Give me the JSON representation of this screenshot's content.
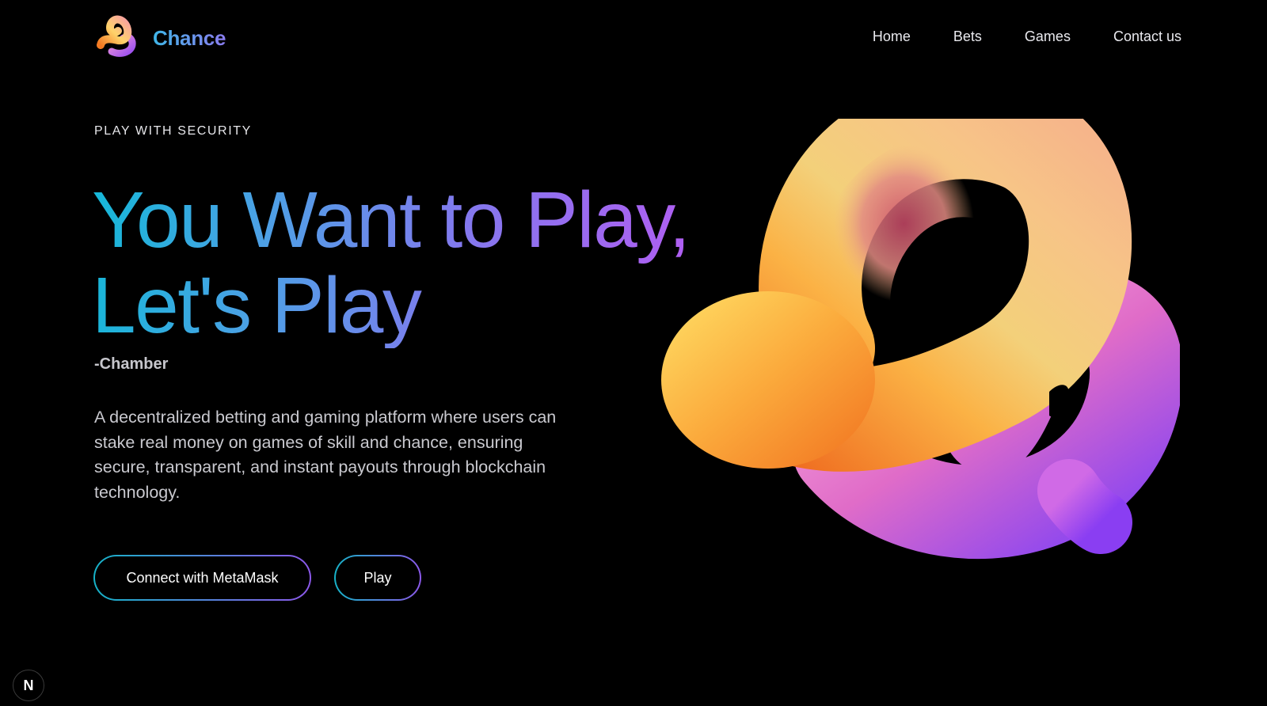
{
  "brand": {
    "name": "Chance",
    "logo_icon": "swirl-knot-icon"
  },
  "nav": {
    "items": [
      {
        "label": "Home"
      },
      {
        "label": "Bets"
      },
      {
        "label": "Games"
      },
      {
        "label": "Contact us"
      }
    ]
  },
  "hero": {
    "eyebrow": "PLAY WITH SECURITY",
    "headline_line1": "You Want to Play,",
    "headline_line2": "Let's Play",
    "author": "-Chamber",
    "description": "A decentralized betting and gaming platform where users can stake real money on games of skill and chance, ensuring secure, transparent, and instant payouts through blockchain technology.",
    "art_icon": "3d-knot-icon"
  },
  "actions": {
    "connect_label": "Connect with MetaMask",
    "play_label": "Play"
  },
  "badge": {
    "label": "N",
    "icon": "nextjs-icon"
  },
  "colors": {
    "background": "#000000",
    "gradient_start": "#15b8d8",
    "gradient_end": "#b25df2",
    "knot_orange": "#f58a2a",
    "knot_pink": "#e36fb4",
    "knot_purple": "#9a4ef0"
  }
}
